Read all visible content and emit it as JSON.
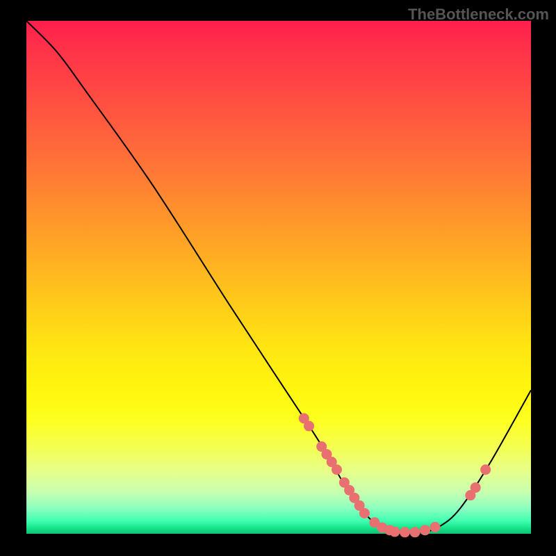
{
  "watermark": "TheBottleneck.com",
  "chart_data": {
    "type": "line",
    "title": "",
    "xlabel": "",
    "ylabel": "",
    "xlim": [
      0,
      100
    ],
    "ylim": [
      0,
      100
    ],
    "grid": false,
    "legend": false,
    "curve": [
      {
        "x": 0,
        "y": 100
      },
      {
        "x": 6,
        "y": 94
      },
      {
        "x": 12,
        "y": 86
      },
      {
        "x": 25,
        "y": 68
      },
      {
        "x": 40,
        "y": 45
      },
      {
        "x": 50,
        "y": 30
      },
      {
        "x": 58,
        "y": 18
      },
      {
        "x": 64,
        "y": 8
      },
      {
        "x": 68,
        "y": 3
      },
      {
        "x": 72,
        "y": 0.5
      },
      {
        "x": 78,
        "y": 0.2
      },
      {
        "x": 82,
        "y": 1.5
      },
      {
        "x": 86,
        "y": 5
      },
      {
        "x": 92,
        "y": 14
      },
      {
        "x": 100,
        "y": 28
      }
    ],
    "markers": [
      {
        "x": 55,
        "y": 22.5
      },
      {
        "x": 56,
        "y": 21
      },
      {
        "x": 58.5,
        "y": 17
      },
      {
        "x": 59.5,
        "y": 15.5
      },
      {
        "x": 60.5,
        "y": 14
      },
      {
        "x": 61.5,
        "y": 12.5
      },
      {
        "x": 63,
        "y": 10
      },
      {
        "x": 64,
        "y": 8.5
      },
      {
        "x": 65,
        "y": 7
      },
      {
        "x": 66,
        "y": 5.5
      },
      {
        "x": 67,
        "y": 4
      },
      {
        "x": 69,
        "y": 2.2
      },
      {
        "x": 70.5,
        "y": 1.2
      },
      {
        "x": 72,
        "y": 0.7
      },
      {
        "x": 73,
        "y": 0.4
      },
      {
        "x": 75,
        "y": 0.3
      },
      {
        "x": 77,
        "y": 0.3
      },
      {
        "x": 79,
        "y": 0.7
      },
      {
        "x": 81,
        "y": 1.3
      },
      {
        "x": 88,
        "y": 7.5
      },
      {
        "x": 89,
        "y": 9
      },
      {
        "x": 91,
        "y": 12.5
      }
    ],
    "marker_color": "#e97070",
    "curve_color": "#000000"
  }
}
